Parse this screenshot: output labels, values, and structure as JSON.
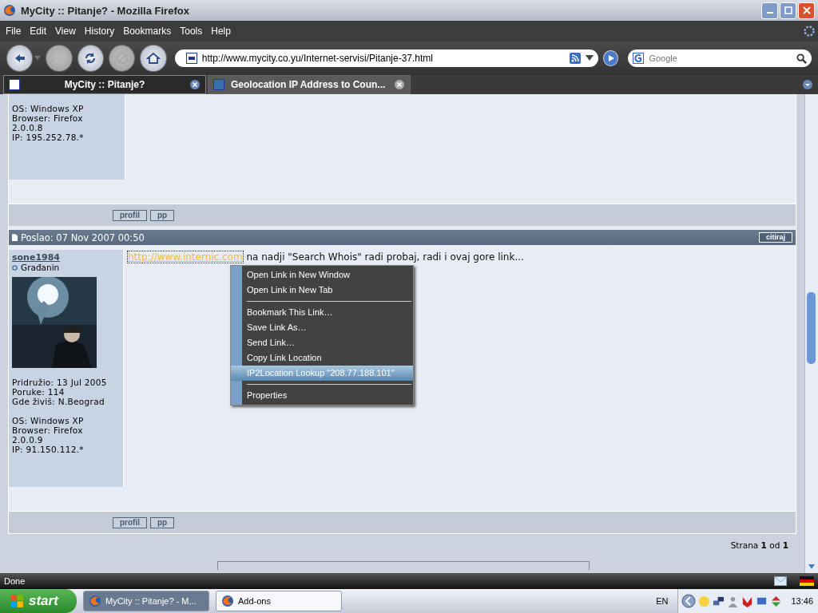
{
  "window": {
    "title": "MyCity :: Pitanje? - Mozilla Firefox"
  },
  "menu": [
    "File",
    "Edit",
    "View",
    "History",
    "Bookmarks",
    "Tools",
    "Help"
  ],
  "toolbar": {
    "url": "http://www.mycity.co.yu/Internet-servisi/Pitanje-37.html",
    "search_placeholder": "Google"
  },
  "tabs": [
    {
      "label": "MyCity :: Pitanje?",
      "selected": true
    },
    {
      "label": "Geolocation IP Address to Coun...",
      "selected": false
    }
  ],
  "earlier_post": {
    "info": [
      "OS: Windows XP",
      "Browser: Firefox",
      "2.0.0.8",
      "IP: 195.252.78.*"
    ],
    "buttons": [
      "profil",
      "pp"
    ]
  },
  "post": {
    "header": "Poslao: 07 Nov 2007 00:50",
    "quote_button": "citiraj",
    "author": "sone1984",
    "rank": "Građanin",
    "avatar": {
      "kind": "picture"
    },
    "details": [
      "Pridružio: 13 Jul 2005",
      "Poruke: 114",
      "Gde živiš: N.Beograd"
    ],
    "system": [
      "OS: Windows XP",
      "Browser: Firefox",
      "2.0.0.9",
      "IP: 91.150.112.*"
    ],
    "link": "http://www.internic.com",
    "text": "na nadji \"Search Whois\" radi probaj, radi i ovaj gore link...",
    "buttons": [
      "profil",
      "pp"
    ]
  },
  "pagination": "Strana **1** od **1**",
  "context_menu": [
    {
      "kind": "item",
      "label": "Open Link in New Window",
      "selected": false
    },
    {
      "kind": "item",
      "label": "Open Link in New Tab",
      "selected": false
    },
    {
      "kind": "separator"
    },
    {
      "kind": "item",
      "label": "Bookmark This Link…",
      "selected": false
    },
    {
      "kind": "item",
      "label": "Save Link As…",
      "selected": false
    },
    {
      "kind": "item",
      "label": "Send Link…",
      "selected": false
    },
    {
      "kind": "item",
      "label": "Copy Link Location",
      "selected": false
    },
    {
      "kind": "item",
      "label": "IP2Location Lookup \"208.77.188.101\"",
      "selected": true
    },
    {
      "kind": "separator"
    },
    {
      "kind": "item",
      "label": "Properties",
      "selected": false
    }
  ],
  "status": "Done",
  "taskbar": {
    "start": "start",
    "tasks": [
      {
        "label": "MyCity :: Pitanje? - M...",
        "selected": true
      },
      {
        "label": "Add-ons",
        "selected": false
      }
    ],
    "language": "EN",
    "clock": "13:46"
  }
}
